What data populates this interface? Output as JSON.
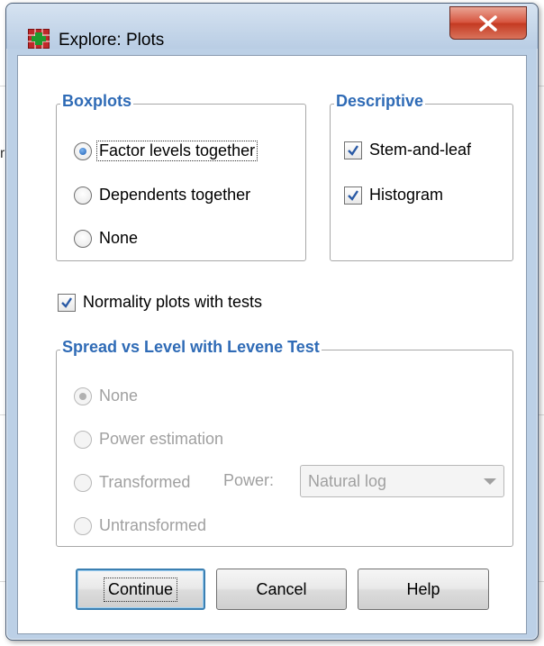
{
  "window": {
    "title": "Explore: Plots"
  },
  "boxplots": {
    "title": "Boxplots",
    "options": [
      {
        "label": "Factor levels together",
        "selected": true
      },
      {
        "label": "Dependents together",
        "selected": false
      },
      {
        "label": "None",
        "selected": false
      }
    ]
  },
  "descriptive": {
    "title": "Descriptive",
    "options": [
      {
        "label": "Stem-and-leaf",
        "checked": true
      },
      {
        "label": "Histogram",
        "checked": true
      }
    ]
  },
  "normality": {
    "label": "Normality plots with tests",
    "checked": true
  },
  "spread": {
    "title": "Spread vs Level with Levene Test",
    "options": [
      {
        "label": "None",
        "selected": true
      },
      {
        "label": "Power estimation",
        "selected": false
      },
      {
        "label": "Transformed",
        "selected": false
      },
      {
        "label": "Untransformed",
        "selected": false
      }
    ],
    "power_label": "Power:",
    "power_value": "Natural log"
  },
  "buttons": {
    "continue": "Continue",
    "cancel": "Cancel",
    "help": "Help"
  },
  "background": {
    "edge_char": "r"
  },
  "colors": {
    "group_title": "#2f6bb6",
    "close": "#c43a22",
    "accent": "#3c7fb1"
  }
}
